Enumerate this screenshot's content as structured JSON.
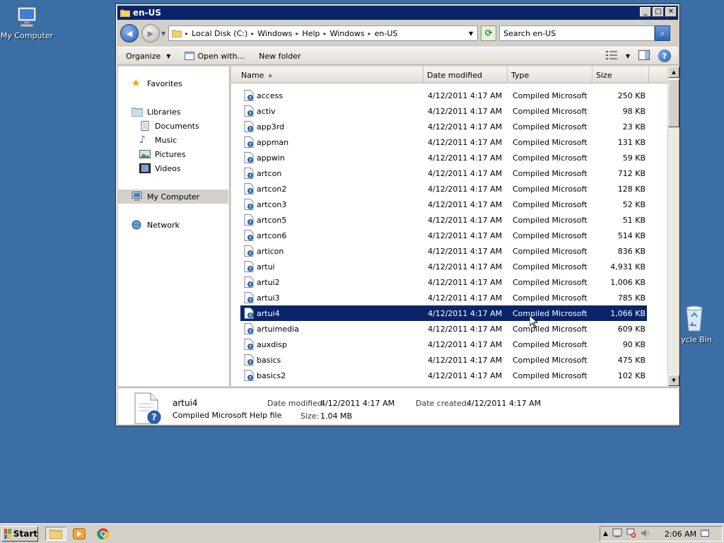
{
  "desktop": {
    "icons": [
      {
        "label": "My Computer"
      },
      {
        "label": "cycle Bin"
      }
    ]
  },
  "window": {
    "title": "en-US",
    "controls": {
      "minimize": "_",
      "maximize": "□",
      "close": "✕"
    }
  },
  "address": {
    "crumbs": [
      "Local Disk (C:)",
      "Windows",
      "Help",
      "Windows",
      "en-US"
    ],
    "search_placeholder": "Search en-US"
  },
  "toolbar": {
    "organize": "Organize",
    "open_with": "Open with...",
    "new_folder": "New folder"
  },
  "nav": {
    "favorites": "Favorites",
    "libraries": "Libraries",
    "documents": "Documents",
    "music": "Music",
    "pictures": "Pictures",
    "videos": "Videos",
    "my_computer": "My Computer",
    "network": "Network"
  },
  "columns": {
    "name": "Name",
    "date": "Date modified",
    "type": "Type",
    "size": "Size"
  },
  "files": [
    {
      "name": "access",
      "date": "4/12/2011 4:17 AM",
      "type": "Compiled Microsoft ...",
      "size": "250 KB"
    },
    {
      "name": "activ",
      "date": "4/12/2011 4:17 AM",
      "type": "Compiled Microsoft ...",
      "size": "98 KB"
    },
    {
      "name": "app3rd",
      "date": "4/12/2011 4:17 AM",
      "type": "Compiled Microsoft ...",
      "size": "23 KB"
    },
    {
      "name": "appman",
      "date": "4/12/2011 4:17 AM",
      "type": "Compiled Microsoft ...",
      "size": "131 KB"
    },
    {
      "name": "appwin",
      "date": "4/12/2011 4:17 AM",
      "type": "Compiled Microsoft ...",
      "size": "59 KB"
    },
    {
      "name": "artcon",
      "date": "4/12/2011 4:17 AM",
      "type": "Compiled Microsoft ...",
      "size": "712 KB"
    },
    {
      "name": "artcon2",
      "date": "4/12/2011 4:17 AM",
      "type": "Compiled Microsoft ...",
      "size": "128 KB"
    },
    {
      "name": "artcon3",
      "date": "4/12/2011 4:17 AM",
      "type": "Compiled Microsoft ...",
      "size": "52 KB"
    },
    {
      "name": "artcon5",
      "date": "4/12/2011 4:17 AM",
      "type": "Compiled Microsoft ...",
      "size": "51 KB"
    },
    {
      "name": "artcon6",
      "date": "4/12/2011 4:17 AM",
      "type": "Compiled Microsoft ...",
      "size": "514 KB"
    },
    {
      "name": "articon",
      "date": "4/12/2011 4:17 AM",
      "type": "Compiled Microsoft ...",
      "size": "836 KB"
    },
    {
      "name": "artui",
      "date": "4/12/2011 4:17 AM",
      "type": "Compiled Microsoft ...",
      "size": "4,931 KB"
    },
    {
      "name": "artui2",
      "date": "4/12/2011 4:17 AM",
      "type": "Compiled Microsoft ...",
      "size": "1,006 KB"
    },
    {
      "name": "artui3",
      "date": "4/12/2011 4:17 AM",
      "type": "Compiled Microsoft ...",
      "size": "785 KB"
    },
    {
      "name": "artui4",
      "date": "4/12/2011 4:17 AM",
      "type": "Compiled Microsoft ...",
      "size": "1,066 KB"
    },
    {
      "name": "artuimedia",
      "date": "4/12/2011 4:17 AM",
      "type": "Compiled Microsoft ...",
      "size": "609 KB"
    },
    {
      "name": "auxdisp",
      "date": "4/12/2011 4:17 AM",
      "type": "Compiled Microsoft ...",
      "size": "90 KB"
    },
    {
      "name": "basics",
      "date": "4/12/2011 4:17 AM",
      "type": "Compiled Microsoft ...",
      "size": "475 KB"
    },
    {
      "name": "basics2",
      "date": "4/12/2011 4:17 AM",
      "type": "Compiled Microsoft ...",
      "size": "102 KB"
    }
  ],
  "selected_file": "artui4",
  "details": {
    "name": "artui4",
    "type": "Compiled Microsoft Help file",
    "modified_label": "Date modified:",
    "modified": "4/12/2011 4:17 AM",
    "created_label": "Date created:",
    "created": "4/12/2011 4:17 AM",
    "size_label": "Size:",
    "size": "1.04 MB"
  },
  "taskbar": {
    "start": "Start",
    "clock": "2:06 AM"
  },
  "colors": {
    "desktop": "#3a6ea5",
    "titlebar": "#0a246a",
    "selection": "#0a246a",
    "chrome": "#d4d0c8"
  }
}
